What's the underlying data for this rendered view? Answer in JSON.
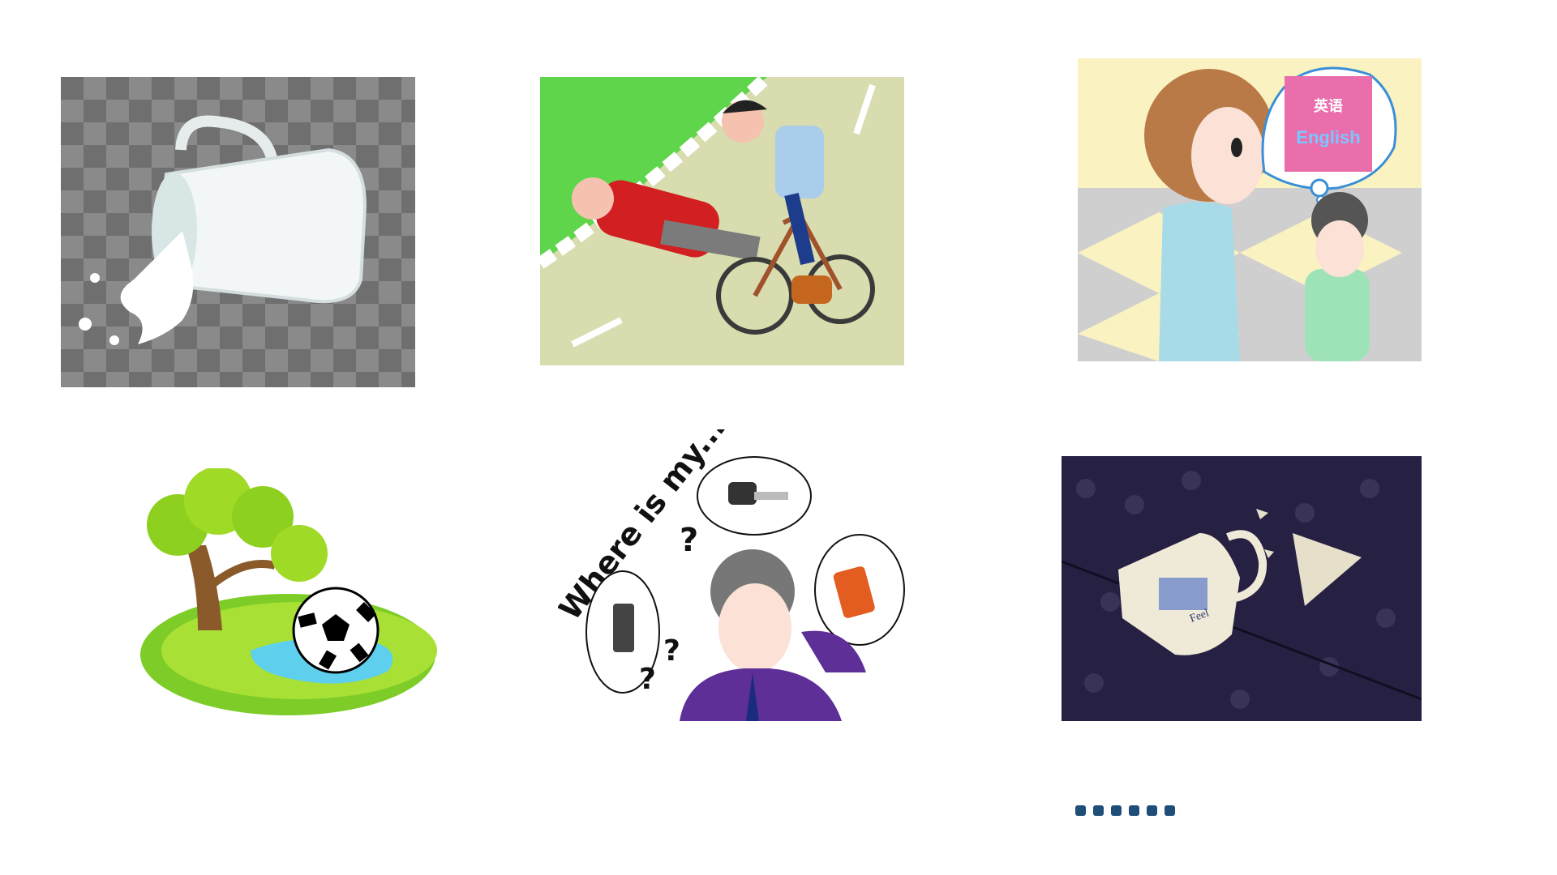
{
  "slide": {
    "images": [
      {
        "id": "p1",
        "icon": "spilled-milk-cup-icon"
      },
      {
        "id": "p2",
        "icon": "bicycle-accident-icon"
      },
      {
        "id": "p3",
        "icon": "forgot-english-book-icon"
      },
      {
        "id": "p4",
        "icon": "ball-in-pond-icon"
      },
      {
        "id": "p5",
        "icon": "lost-items-icon"
      },
      {
        "id": "p6",
        "icon": "broken-mug-icon"
      }
    ],
    "lost_items_caption": "Where is my...?",
    "book_cover_cn": "英语",
    "book_cover_en": "English",
    "mug_print": "Feel",
    "ellipsis": "......",
    "ellipsis_color": "#1f4e79"
  }
}
